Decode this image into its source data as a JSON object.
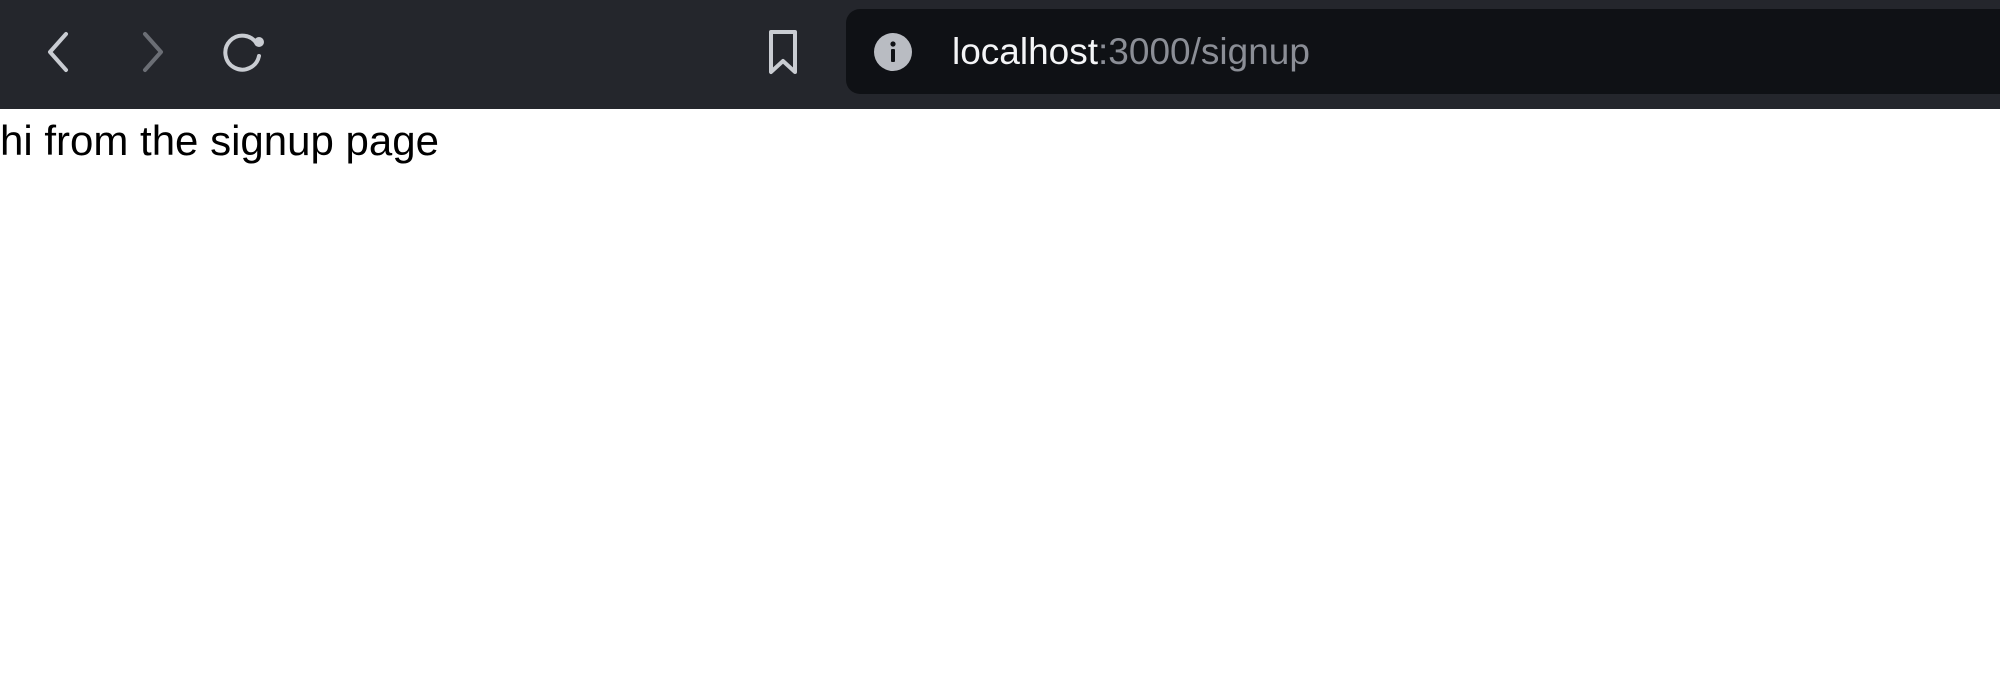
{
  "browser": {
    "toolbar_color": "#24262c",
    "urlbar_color": "#0f1115",
    "icons": {
      "back": "chevron-left-icon",
      "forward": "chevron-right-icon",
      "reload": "reload-icon",
      "bookmark": "bookmark-icon",
      "info": "info-icon"
    },
    "address": {
      "host": "localhost",
      "rest": ":3000/signup"
    }
  },
  "page": {
    "text": "hi from the signup page"
  }
}
